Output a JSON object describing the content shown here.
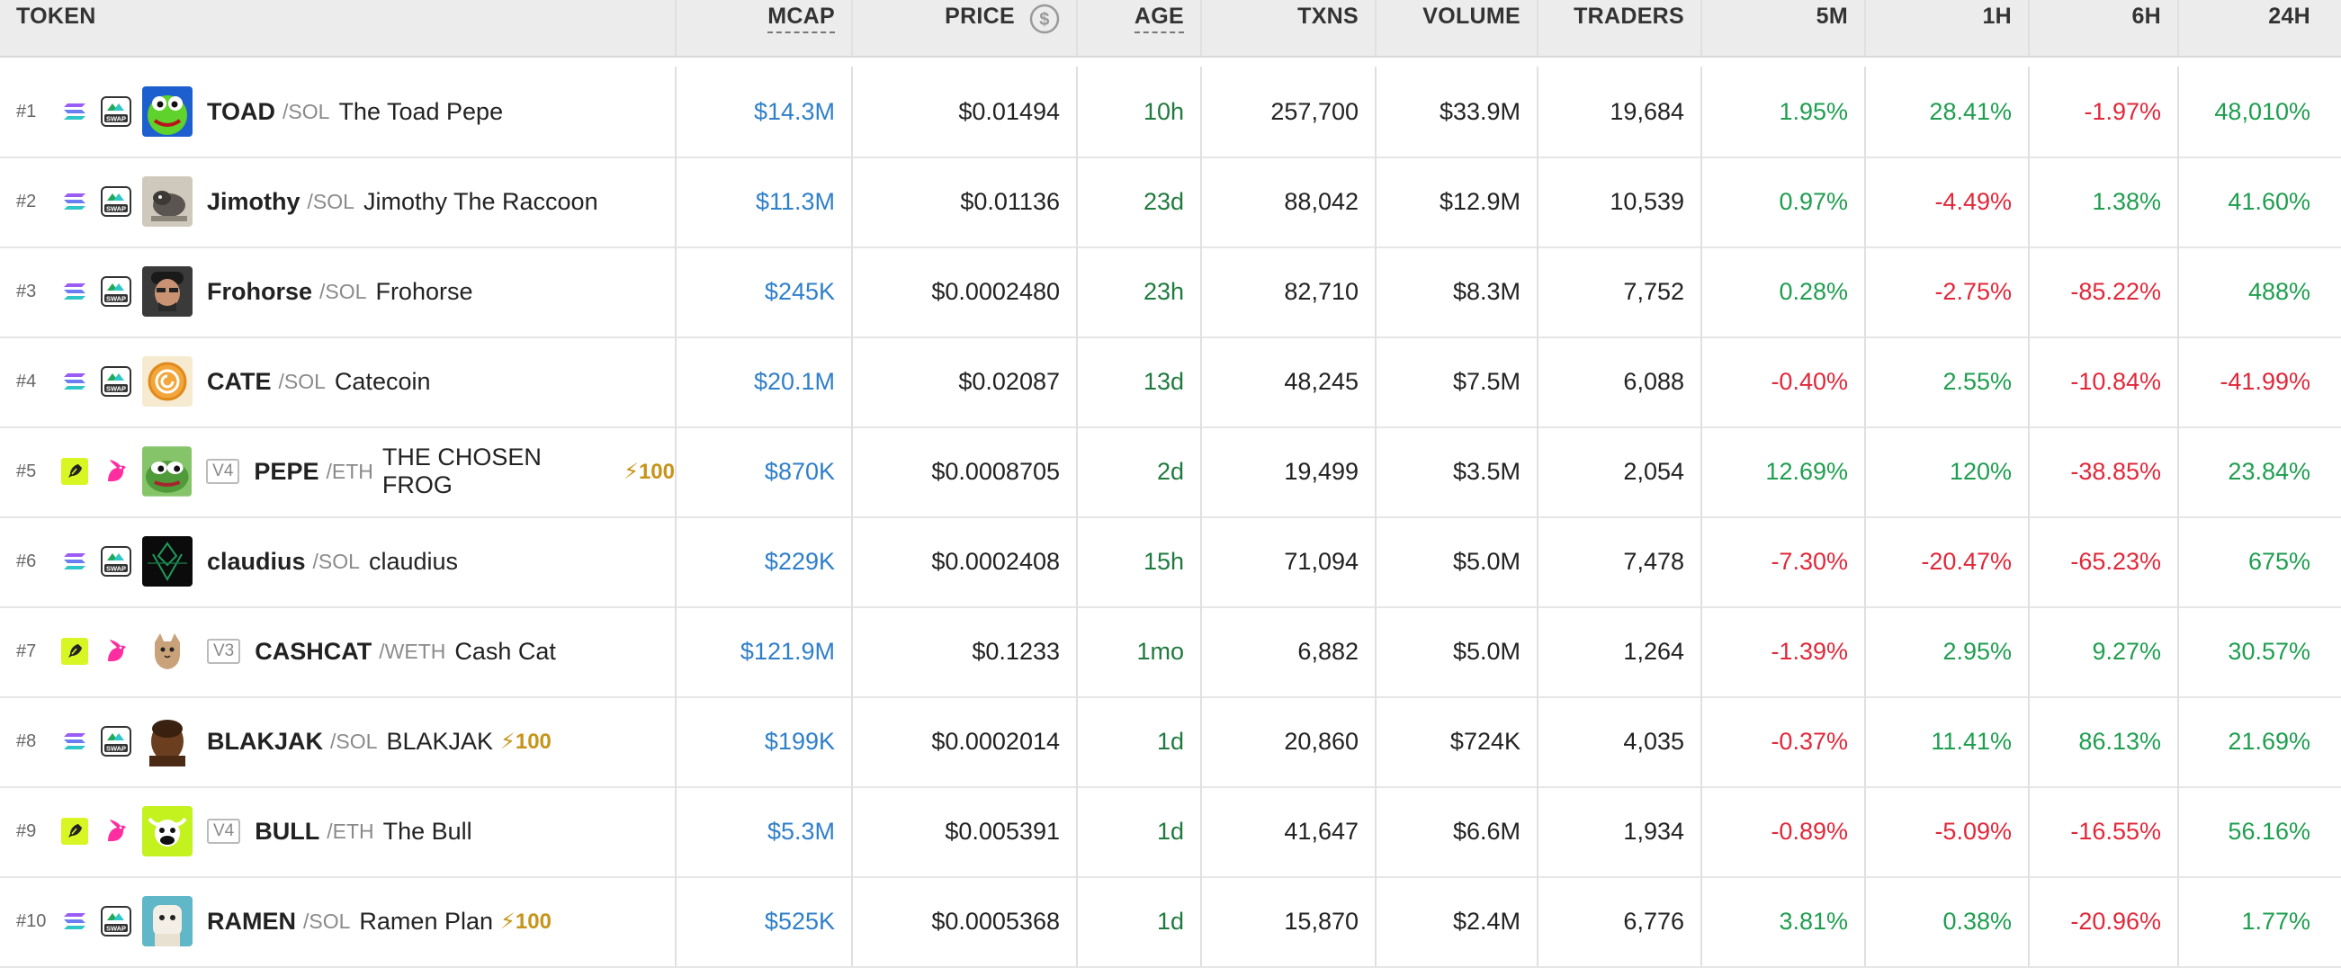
{
  "columns": {
    "token": "TOKEN",
    "mcap": "MCAP",
    "price": "PRICE",
    "age": "AGE",
    "txns": "TXNS",
    "volume": "VOLUME",
    "traders": "TRADERS",
    "m5": "5M",
    "h1": "1H",
    "h6": "6H",
    "h24": "24H"
  },
  "colors": {
    "positive": "#1f9e4f",
    "negative": "#e0283a",
    "mcap": "#2f7fc9",
    "boost": "#c7941a"
  },
  "rows": [
    {
      "rank": "#1",
      "chain": "solana-icon",
      "dex": "raydium-swap-icon",
      "avatar": "toad-avatar",
      "version": "",
      "symbol": "TOAD",
      "quote": "/SOL",
      "name": "The Toad Pepe",
      "boost": "",
      "mcap": "$14.3M",
      "price": "$0.01494",
      "age": "10h",
      "txns": "257,700",
      "volume": "$33.9M",
      "traders": "19,684",
      "m5": "1.95%",
      "h1": "28.41%",
      "h6": "-1.97%",
      "h24": "48,010%"
    },
    {
      "rank": "#2",
      "chain": "solana-icon",
      "dex": "raydium-swap-icon",
      "avatar": "raccoon-avatar",
      "version": "",
      "symbol": "Jimothy",
      "quote": "/SOL",
      "name": "Jimothy The Raccoon",
      "boost": "",
      "mcap": "$11.3M",
      "price": "$0.01136",
      "age": "23d",
      "txns": "88,042",
      "volume": "$12.9M",
      "traders": "10,539",
      "m5": "0.97%",
      "h1": "-4.49%",
      "h6": "1.38%",
      "h24": "41.60%"
    },
    {
      "rank": "#3",
      "chain": "solana-icon",
      "dex": "raydium-swap-icon",
      "avatar": "frohorse-avatar",
      "version": "",
      "symbol": "Frohorse",
      "quote": "/SOL",
      "name": "Frohorse",
      "boost": "",
      "mcap": "$245K",
      "price": "$0.0002480",
      "age": "23h",
      "txns": "82,710",
      "volume": "$8.3M",
      "traders": "7,752",
      "m5": "0.28%",
      "h1": "-2.75%",
      "h6": "-85.22%",
      "h24": "488%"
    },
    {
      "rank": "#4",
      "chain": "solana-icon",
      "dex": "raydium-swap-icon",
      "avatar": "catecoin-avatar",
      "version": "",
      "symbol": "CATE",
      "quote": "/SOL",
      "name": "Catecoin",
      "boost": "",
      "mcap": "$20.1M",
      "price": "$0.02087",
      "age": "13d",
      "txns": "48,245",
      "volume": "$7.5M",
      "traders": "6,088",
      "m5": "-0.40%",
      "h1": "2.55%",
      "h6": "-10.84%",
      "h24": "-41.99%"
    },
    {
      "rank": "#5",
      "chain": "ethereum-icon",
      "dex": "uniswap-icon",
      "avatar": "pepe-avatar",
      "version": "V4",
      "symbol": "PEPE",
      "quote": "/ETH",
      "name": "THE CHOSEN FROG",
      "boost": "⚡100",
      "mcap": "$870K",
      "price": "$0.0008705",
      "age": "2d",
      "txns": "19,499",
      "volume": "$3.5M",
      "traders": "2,054",
      "m5": "12.69%",
      "h1": "120%",
      "h6": "-38.85%",
      "h24": "23.84%"
    },
    {
      "rank": "#6",
      "chain": "solana-icon",
      "dex": "raydium-swap-icon",
      "avatar": "claudius-avatar",
      "version": "",
      "symbol": "claudius",
      "quote": "/SOL",
      "name": "claudius",
      "boost": "",
      "mcap": "$229K",
      "price": "$0.0002408",
      "age": "15h",
      "txns": "71,094",
      "volume": "$5.0M",
      "traders": "7,478",
      "m5": "-7.30%",
      "h1": "-20.47%",
      "h6": "-65.23%",
      "h24": "675%"
    },
    {
      "rank": "#7",
      "chain": "ethereum-icon",
      "dex": "uniswap-icon",
      "avatar": "cashcat-avatar",
      "version": "V3",
      "symbol": "CASHCAT",
      "quote": "/WETH",
      "name": "Cash Cat",
      "boost": "",
      "mcap": "$121.9M",
      "price": "$0.1233",
      "age": "1mo",
      "txns": "6,882",
      "volume": "$5.0M",
      "traders": "1,264",
      "m5": "-1.39%",
      "h1": "2.95%",
      "h6": "9.27%",
      "h24": "30.57%"
    },
    {
      "rank": "#8",
      "chain": "solana-icon",
      "dex": "raydium-swap-icon",
      "avatar": "blakjak-avatar",
      "version": "",
      "symbol": "BLAKJAK",
      "quote": "/SOL",
      "name": "BLAKJAK",
      "boost": "⚡100",
      "mcap": "$199K",
      "price": "$0.0002014",
      "age": "1d",
      "txns": "20,860",
      "volume": "$724K",
      "traders": "4,035",
      "m5": "-0.37%",
      "h1": "11.41%",
      "h6": "86.13%",
      "h24": "21.69%"
    },
    {
      "rank": "#9",
      "chain": "ethereum-icon",
      "dex": "uniswap-icon",
      "avatar": "bull-avatar",
      "version": "V4",
      "symbol": "BULL",
      "quote": "/ETH",
      "name": "The Bull",
      "boost": "",
      "mcap": "$5.3M",
      "price": "$0.005391",
      "age": "1d",
      "txns": "41,647",
      "volume": "$6.6M",
      "traders": "1,934",
      "m5": "-0.89%",
      "h1": "-5.09%",
      "h6": "-16.55%",
      "h24": "56.16%"
    },
    {
      "rank": "#10",
      "chain": "solana-icon",
      "dex": "raydium-swap-icon",
      "avatar": "ramen-avatar",
      "version": "",
      "symbol": "RAMEN",
      "quote": "/SOL",
      "name": "Ramen Plan",
      "boost": "⚡100",
      "mcap": "$525K",
      "price": "$0.0005368",
      "age": "1d",
      "txns": "15,870",
      "volume": "$2.4M",
      "traders": "6,776",
      "m5": "3.81%",
      "h1": "0.38%",
      "h6": "-20.96%",
      "h24": "1.77%"
    }
  ]
}
